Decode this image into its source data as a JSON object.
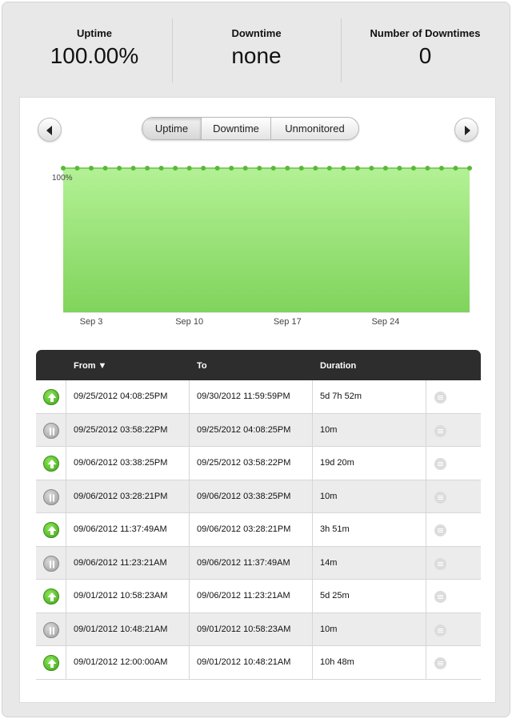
{
  "stats": [
    {
      "label": "Uptime",
      "value": "100.00%"
    },
    {
      "label": "Downtime",
      "value": "none"
    },
    {
      "label": "Number of Downtimes",
      "value": "0"
    }
  ],
  "tabs": [
    {
      "label": "Uptime",
      "active": true
    },
    {
      "label": "Downtime",
      "active": false
    },
    {
      "label": "Unmonitored",
      "active": false
    }
  ],
  "chart_data": {
    "type": "area",
    "series": [
      {
        "values": [
          100,
          100,
          100,
          100,
          100,
          100,
          100,
          100,
          100,
          100,
          100,
          100,
          100,
          100,
          100,
          100,
          100,
          100,
          100,
          100,
          100,
          100,
          100,
          100,
          100,
          100,
          100,
          100,
          100,
          100
        ]
      }
    ],
    "x_tick_labels": [
      "Sep 3",
      "Sep 10",
      "Sep 17",
      "Sep 24"
    ],
    "y_annotation": "100%",
    "colors": {
      "fill_top": "#b3f195",
      "fill_bottom": "#80d45c",
      "line": "#6cc04a",
      "point": "#5ab83a"
    }
  },
  "table": {
    "headers": {
      "from": "From ▼",
      "to": "To",
      "duration": "Duration"
    },
    "rows": [
      {
        "status": "up",
        "from": "09/25/2012 04:08:25PM",
        "to": "09/30/2012 11:59:59PM",
        "duration": "5d 7h 52m"
      },
      {
        "status": "paused",
        "from": "09/25/2012 03:58:22PM",
        "to": "09/25/2012 04:08:25PM",
        "duration": "10m"
      },
      {
        "status": "up",
        "from": "09/06/2012 03:38:25PM",
        "to": "09/25/2012 03:58:22PM",
        "duration": "19d 20m"
      },
      {
        "status": "paused",
        "from": "09/06/2012 03:28:21PM",
        "to": "09/06/2012 03:38:25PM",
        "duration": "10m"
      },
      {
        "status": "up",
        "from": "09/06/2012 11:37:49AM",
        "to": "09/06/2012 03:28:21PM",
        "duration": "3h 51m"
      },
      {
        "status": "paused",
        "from": "09/06/2012 11:23:21AM",
        "to": "09/06/2012 11:37:49AM",
        "duration": "14m"
      },
      {
        "status": "up",
        "from": "09/01/2012 10:58:23AM",
        "to": "09/06/2012 11:23:21AM",
        "duration": "5d 25m"
      },
      {
        "status": "paused",
        "from": "09/01/2012 10:48:21AM",
        "to": "09/01/2012 10:58:23AM",
        "duration": "10m"
      },
      {
        "status": "up",
        "from": "09/01/2012 12:00:00AM",
        "to": "09/01/2012 10:48:21AM",
        "duration": "10h 48m"
      }
    ]
  }
}
